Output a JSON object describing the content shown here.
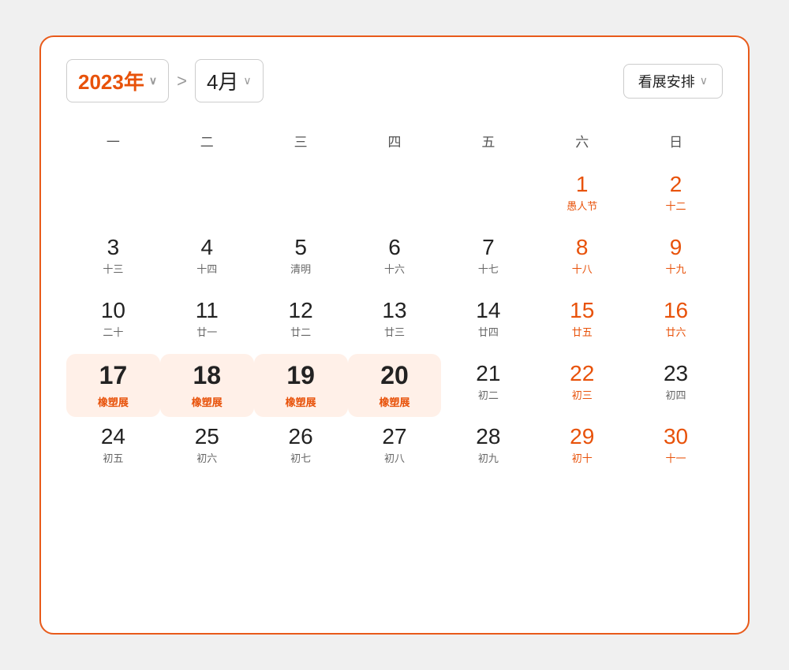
{
  "header": {
    "year_label": "2023年",
    "year_arrow": "∨",
    "sep": ">",
    "month_label": "4月",
    "month_arrow": "∨",
    "view_label": "看展安排",
    "view_arrow": "∨"
  },
  "weekdays": [
    "一",
    "二",
    "三",
    "四",
    "五",
    "六",
    "日"
  ],
  "weeks": [
    [
      {
        "num": "",
        "sub": "",
        "red": false,
        "bold": false,
        "highlight": false,
        "event": ""
      },
      {
        "num": "",
        "sub": "",
        "red": false,
        "bold": false,
        "highlight": false,
        "event": ""
      },
      {
        "num": "",
        "sub": "",
        "red": false,
        "bold": false,
        "highlight": false,
        "event": ""
      },
      {
        "num": "",
        "sub": "",
        "red": false,
        "bold": false,
        "highlight": false,
        "event": ""
      },
      {
        "num": "",
        "sub": "",
        "red": false,
        "bold": false,
        "highlight": false,
        "event": ""
      },
      {
        "num": "1",
        "sub": "愚人节",
        "red": true,
        "bold": false,
        "highlight": false,
        "event": ""
      },
      {
        "num": "2",
        "sub": "十二",
        "red": true,
        "bold": false,
        "highlight": false,
        "event": ""
      }
    ],
    [
      {
        "num": "3",
        "sub": "十三",
        "red": false,
        "bold": false,
        "highlight": false,
        "event": ""
      },
      {
        "num": "4",
        "sub": "十四",
        "red": false,
        "bold": false,
        "highlight": false,
        "event": ""
      },
      {
        "num": "5",
        "sub": "清明",
        "red": false,
        "bold": false,
        "highlight": false,
        "event": ""
      },
      {
        "num": "6",
        "sub": "十六",
        "red": false,
        "bold": false,
        "highlight": false,
        "event": ""
      },
      {
        "num": "7",
        "sub": "十七",
        "red": false,
        "bold": false,
        "highlight": false,
        "event": ""
      },
      {
        "num": "8",
        "sub": "十八",
        "red": true,
        "bold": false,
        "highlight": false,
        "event": ""
      },
      {
        "num": "9",
        "sub": "十九",
        "red": true,
        "bold": false,
        "highlight": false,
        "event": ""
      }
    ],
    [
      {
        "num": "10",
        "sub": "二十",
        "red": false,
        "bold": false,
        "highlight": false,
        "event": ""
      },
      {
        "num": "11",
        "sub": "廿一",
        "red": false,
        "bold": false,
        "highlight": false,
        "event": ""
      },
      {
        "num": "12",
        "sub": "廿二",
        "red": false,
        "bold": false,
        "highlight": false,
        "event": ""
      },
      {
        "num": "13",
        "sub": "廿三",
        "red": false,
        "bold": false,
        "highlight": false,
        "event": ""
      },
      {
        "num": "14",
        "sub": "廿四",
        "red": false,
        "bold": false,
        "highlight": false,
        "event": ""
      },
      {
        "num": "15",
        "sub": "廿五",
        "red": true,
        "bold": false,
        "highlight": false,
        "event": ""
      },
      {
        "num": "16",
        "sub": "廿六",
        "red": true,
        "bold": false,
        "highlight": false,
        "event": ""
      }
    ],
    [
      {
        "num": "17",
        "sub": "",
        "red": false,
        "bold": true,
        "highlight": true,
        "event": "橡塑展"
      },
      {
        "num": "18",
        "sub": "",
        "red": false,
        "bold": true,
        "highlight": true,
        "event": "橡塑展"
      },
      {
        "num": "19",
        "sub": "",
        "red": false,
        "bold": true,
        "highlight": true,
        "event": "橡塑展"
      },
      {
        "num": "20",
        "sub": "",
        "red": false,
        "bold": true,
        "highlight": true,
        "event": "橡塑展"
      },
      {
        "num": "21",
        "sub": "初二",
        "red": false,
        "bold": false,
        "highlight": false,
        "event": ""
      },
      {
        "num": "22",
        "sub": "初三",
        "red": true,
        "bold": false,
        "highlight": false,
        "event": ""
      },
      {
        "num": "23",
        "sub": "初四",
        "red": false,
        "bold": false,
        "highlight": false,
        "event": ""
      }
    ],
    [
      {
        "num": "24",
        "sub": "初五",
        "red": false,
        "bold": false,
        "highlight": false,
        "event": ""
      },
      {
        "num": "25",
        "sub": "初六",
        "red": false,
        "bold": false,
        "highlight": false,
        "event": ""
      },
      {
        "num": "26",
        "sub": "初七",
        "red": false,
        "bold": false,
        "highlight": false,
        "event": ""
      },
      {
        "num": "27",
        "sub": "初八",
        "red": false,
        "bold": false,
        "highlight": false,
        "event": ""
      },
      {
        "num": "28",
        "sub": "初九",
        "red": false,
        "bold": false,
        "highlight": false,
        "event": ""
      },
      {
        "num": "29",
        "sub": "初十",
        "red": true,
        "bold": false,
        "highlight": false,
        "event": ""
      },
      {
        "num": "30",
        "sub": "十一",
        "red": true,
        "bold": false,
        "highlight": false,
        "event": ""
      }
    ]
  ]
}
